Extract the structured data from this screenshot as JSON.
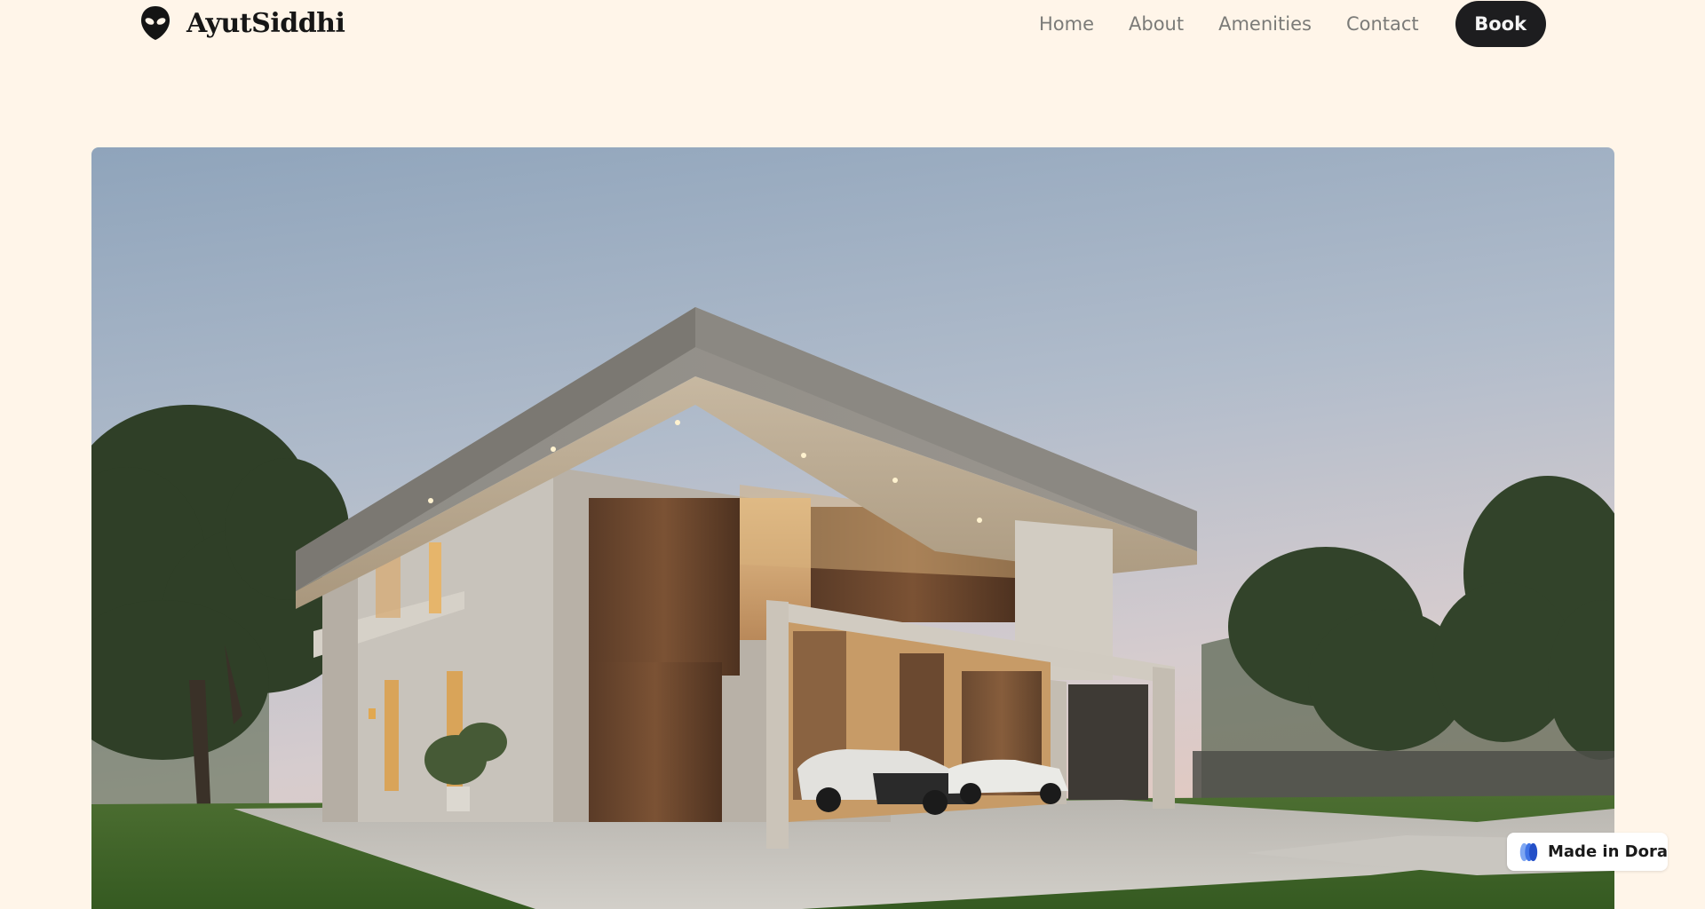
{
  "brand": {
    "name": "AyutSiddhi",
    "logo_icon": "alien-head-icon"
  },
  "nav": {
    "links": [
      {
        "label": "Home"
      },
      {
        "label": "About"
      },
      {
        "label": "Amenities"
      },
      {
        "label": "Contact"
      }
    ],
    "cta_label": "Book"
  },
  "hero": {
    "image_icon": "modern-house-photo"
  },
  "badge": {
    "label": "Made in Dora",
    "icon": "dora-logo-icon"
  },
  "colors": {
    "page_background": "#fff5e9",
    "button_dark": "#1d1d1f",
    "nav_text": "#7b7b78",
    "brand_text": "#161616"
  }
}
